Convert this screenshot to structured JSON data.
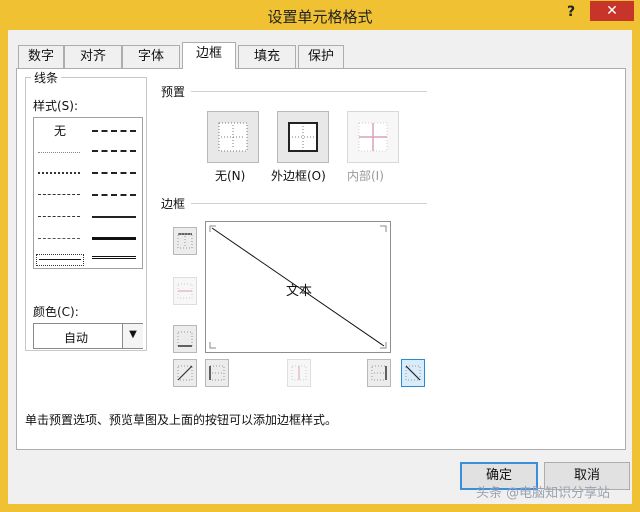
{
  "dialog": {
    "title": "设置单元格格式",
    "help_label": "?",
    "close_label": "✕"
  },
  "tabs": [
    {
      "label": "数字"
    },
    {
      "label": "对齐"
    },
    {
      "label": "字体"
    },
    {
      "label": "边框",
      "active": true
    },
    {
      "label": "填充"
    },
    {
      "label": "保护"
    }
  ],
  "line_group": {
    "title": "线条",
    "style_label": "样式(S):",
    "none_style_label": "无",
    "color_label": "颜色(C):",
    "color_value": "自动",
    "color_dropdown_icon": "chevron-down-icon"
  },
  "presets": {
    "title": "预置",
    "buttons": [
      {
        "label": "无(N)",
        "icon": "no-border-icon",
        "enabled": true
      },
      {
        "label": "外边框(O)",
        "icon": "outline-border-icon",
        "enabled": true
      },
      {
        "label": "内部(I)",
        "icon": "inside-border-icon",
        "enabled": false
      }
    ]
  },
  "border": {
    "title": "边框",
    "preview_text": "文本"
  },
  "hint_text": "单击预置选项、预览草图及上面的按钮可以添加边框样式。",
  "footer": {
    "ok_label": "确定",
    "cancel_label": "取消"
  },
  "watermark": "头条 @电脑知识分享站",
  "colors": {
    "titlebar": "#f0c233",
    "close_button": "#c7352a",
    "accent": "#2a8ad4",
    "panel": "#ffffff",
    "dialog_background": "#f0f0f0"
  }
}
